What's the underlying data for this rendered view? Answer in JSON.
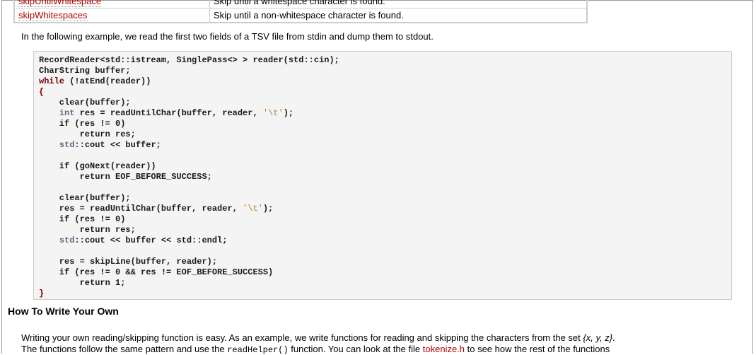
{
  "table": [
    {
      "name": "skipUntilWhitespace",
      "desc": "Skip until a whitespace character is found."
    },
    {
      "name": "skipWhitespaces",
      "desc": "Skip until a non-whitespace character is found."
    }
  ],
  "intro": "In the following example, we read the first two fields of a TSV file from stdin and dump them to stdout.",
  "code": [
    [
      [
        "RecordReader<std::istream, SinglePass<> > reader(std::cin);",
        ""
      ]
    ],
    [
      [
        "CharString buffer;",
        ""
      ]
    ],
    [
      [
        "while",
        "kw"
      ],
      [
        " (!atEnd(reader))",
        ""
      ]
    ],
    [
      [
        "{",
        "kw"
      ]
    ],
    [
      [
        "    clear(buffer);",
        ""
      ]
    ],
    [
      [
        "    ",
        ""
      ],
      [
        "int",
        "ty"
      ],
      [
        " res = readUntilChar(buffer, reader, ",
        ""
      ],
      [
        "'\\t'",
        "st"
      ],
      [
        ");",
        ""
      ]
    ],
    [
      [
        "    if (res != 0)",
        ""
      ]
    ],
    [
      [
        "        return res;",
        ""
      ]
    ],
    [
      [
        "    ",
        ""
      ],
      [
        "std",
        "ty"
      ],
      [
        "::cout << buffer;",
        ""
      ]
    ],
    [
      [
        "",
        ""
      ]
    ],
    [
      [
        "    if (goNext(reader))",
        ""
      ]
    ],
    [
      [
        "        return EOF_BEFORE_SUCCESS;",
        ""
      ]
    ],
    [
      [
        "",
        ""
      ]
    ],
    [
      [
        "    clear(buffer);",
        ""
      ]
    ],
    [
      [
        "    res = readUntilChar(buffer, reader, ",
        ""
      ],
      [
        "'\\t'",
        "st"
      ],
      [
        ");",
        ""
      ]
    ],
    [
      [
        "    if (res != 0)",
        ""
      ]
    ],
    [
      [
        "        return res;",
        ""
      ]
    ],
    [
      [
        "    ",
        ""
      ],
      [
        "std",
        "ty"
      ],
      [
        "::cout << buffer << std::endl;",
        ""
      ]
    ],
    [
      [
        "",
        ""
      ]
    ],
    [
      [
        "    res = skipLine(buffer, reader);",
        ""
      ]
    ],
    [
      [
        "    if (res != 0 && res != EOF_BEFORE_SUCCESS)",
        ""
      ]
    ],
    [
      [
        "        return 1;",
        ""
      ]
    ],
    [
      [
        "}",
        "kw"
      ]
    ]
  ],
  "heading": "How To Write Your Own",
  "para": {
    "l1": "Writing your own reading/skipping function is easy. As an example, we write functions for reading and skipping the characters from the set ",
    "set": "{x, y, z}",
    "l1end": ".",
    "l2a": "The functions follow the same pattern and use the ",
    "code": "readHelper()",
    "l2b": " function. You can look at the file ",
    "link": "tokenize.h",
    "l2c": " to see how the rest of the functions"
  }
}
